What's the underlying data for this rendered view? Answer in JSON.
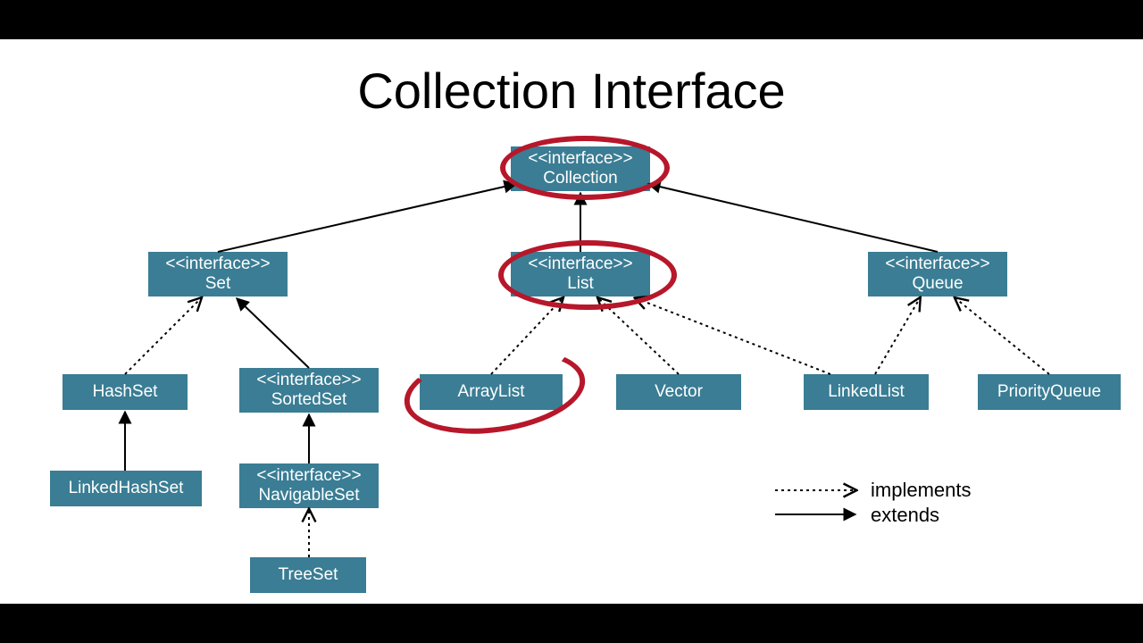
{
  "title": "Collection Interface",
  "stereotype_label": "<<interface>>",
  "nodes": {
    "collection": {
      "name": "Collection",
      "is_interface": true
    },
    "set": {
      "name": "Set",
      "is_interface": true
    },
    "list": {
      "name": "List",
      "is_interface": true
    },
    "queue": {
      "name": "Queue",
      "is_interface": true
    },
    "hashset": {
      "name": "HashSet",
      "is_interface": false
    },
    "sortedset": {
      "name": "SortedSet",
      "is_interface": true
    },
    "arraylist": {
      "name": "ArrayList",
      "is_interface": false
    },
    "vector": {
      "name": "Vector",
      "is_interface": false
    },
    "linkedlist": {
      "name": "LinkedList",
      "is_interface": false
    },
    "priorityqueue": {
      "name": "PriorityQueue",
      "is_interface": false
    },
    "linkedhashset": {
      "name": "LinkedHashSet",
      "is_interface": false
    },
    "navigableset": {
      "name": "NavigableSet",
      "is_interface": true
    },
    "treeset": {
      "name": "TreeSet",
      "is_interface": false
    }
  },
  "edges": [
    {
      "from": "set",
      "to": "collection",
      "kind": "extends"
    },
    {
      "from": "list",
      "to": "collection",
      "kind": "extends"
    },
    {
      "from": "queue",
      "to": "collection",
      "kind": "extends"
    },
    {
      "from": "hashset",
      "to": "set",
      "kind": "implements"
    },
    {
      "from": "sortedset",
      "to": "set",
      "kind": "extends"
    },
    {
      "from": "arraylist",
      "to": "list",
      "kind": "implements"
    },
    {
      "from": "vector",
      "to": "list",
      "kind": "implements"
    },
    {
      "from": "linkedlist",
      "to": "list",
      "kind": "implements"
    },
    {
      "from": "linkedlist",
      "to": "queue",
      "kind": "implements"
    },
    {
      "from": "priorityqueue",
      "to": "queue",
      "kind": "implements"
    },
    {
      "from": "linkedhashset",
      "to": "hashset",
      "kind": "extends"
    },
    {
      "from": "navigableset",
      "to": "sortedset",
      "kind": "extends"
    },
    {
      "from": "treeset",
      "to": "navigableset",
      "kind": "implements"
    }
  ],
  "highlighted": [
    "collection",
    "list",
    "arraylist"
  ],
  "legend": {
    "implements": "implements",
    "extends": "extends"
  },
  "colors": {
    "box_bg": "#3a7d94",
    "box_fg": "#ffffff",
    "edge": "#000000",
    "highlight": "#b7172a"
  }
}
